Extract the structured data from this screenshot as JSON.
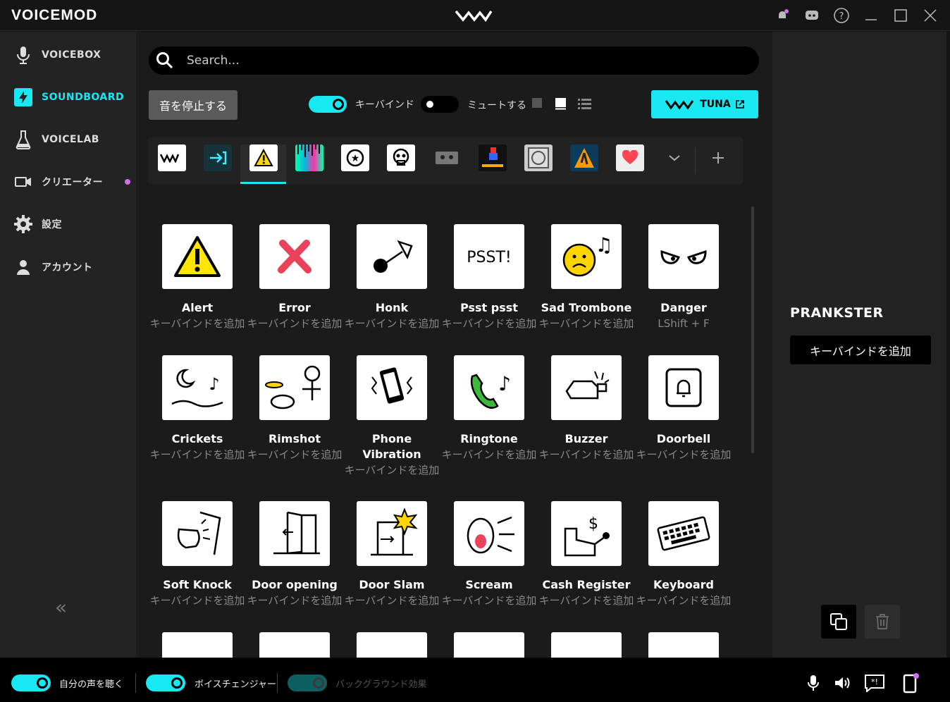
{
  "app": {
    "logo": "VOICEMOD"
  },
  "sidebar": {
    "items": [
      {
        "label": "VOICEBOX"
      },
      {
        "label": "SOUNDBOARD"
      },
      {
        "label": "VOICELAB"
      },
      {
        "label": "クリエーター"
      },
      {
        "label": "設定"
      },
      {
        "label": "アカウント"
      }
    ],
    "collapse": "«"
  },
  "search": {
    "placeholder": "Search..."
  },
  "toolbar": {
    "stop_label": "音を停止する",
    "keybind_label": "キーバインド",
    "mute_label": "ミュートする",
    "tuna_label": "TUNA"
  },
  "sounds": [
    {
      "name": "Alert",
      "key": "キーバインドを追加"
    },
    {
      "name": "Error",
      "key": "キーバインドを追加"
    },
    {
      "name": "Honk",
      "key": "キーバインドを追加"
    },
    {
      "name": "Psst psst",
      "key": "キーバインドを追加"
    },
    {
      "name": "Sad Trombone",
      "key": "キーバインドを追加"
    },
    {
      "name": "Danger",
      "key": "LShift + F"
    },
    {
      "name": "Crickets",
      "key": "キーバインドを追加"
    },
    {
      "name": "Rimshot",
      "key": "キーバインドを追加"
    },
    {
      "name": "Phone Vibration",
      "key": "キーバインドを追加"
    },
    {
      "name": "Ringtone",
      "key": "キーバインドを追加"
    },
    {
      "name": "Buzzer",
      "key": "キーバインドを追加"
    },
    {
      "name": "Doorbell",
      "key": "キーバインドを追加"
    },
    {
      "name": "Soft Knock",
      "key": "キーバインドを追加"
    },
    {
      "name": "Door opening",
      "key": "キーバインドを追加"
    },
    {
      "name": "Door Slam",
      "key": "キーバインドを追加"
    },
    {
      "name": "Scream",
      "key": "キーバインドを追加"
    },
    {
      "name": "Cash Register",
      "key": "キーバインドを追加"
    },
    {
      "name": "Keyboard",
      "key": "キーバインドを追加"
    }
  ],
  "panel": {
    "title": "PRANKSTER",
    "keybind_label": "キーバインドを追加"
  },
  "bottom": {
    "hear_label": "自分の声を聴く",
    "changer_label": "ボイスチェンジャー",
    "background_label": "バックグラウンド効果"
  }
}
